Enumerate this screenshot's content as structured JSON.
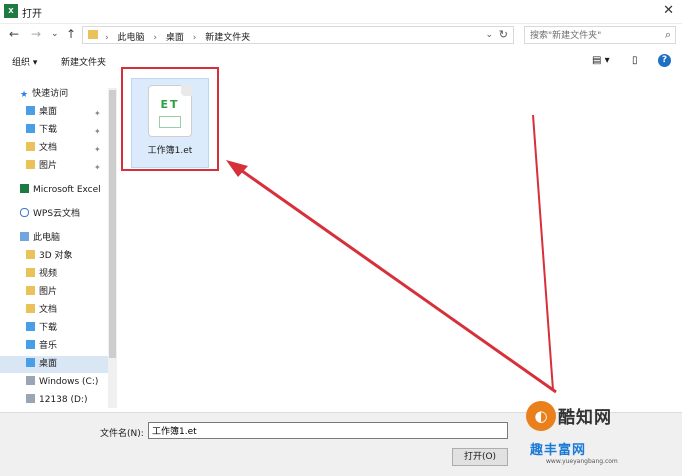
{
  "window": {
    "title": "打开",
    "app_icon_text": "X"
  },
  "nav": {
    "back": "←",
    "forward": "→",
    "recent": "⌄",
    "up": "↑",
    "breadcrumb": [
      "此电脑",
      "桌面",
      "新建文件夹"
    ],
    "search_placeholder": "搜索\"新建文件夹\""
  },
  "toolbar": {
    "organize": "组织 ▾",
    "new_folder": "新建文件夹",
    "help": "?"
  },
  "sidebar": {
    "quick_access": "快速访问",
    "quick_items": [
      "桌面",
      "下载",
      "文档",
      "图片"
    ],
    "excel": "Microsoft Excel",
    "wps": "WPS云文档",
    "this_pc": "此电脑",
    "pc_items": [
      "3D 对象",
      "视频",
      "图片",
      "文档",
      "下载",
      "音乐",
      "桌面",
      "Windows (C:)",
      "12138 (D:)"
    ]
  },
  "file": {
    "icon_text": "ET",
    "name": "工作簿1.et"
  },
  "footer": {
    "filename_label": "文件名(N):",
    "filename_value": "工作簿1.et",
    "open_button": "打开(O)"
  },
  "watermark": {
    "brand": "酷知网",
    "site": "趣丰富网",
    "url": "www.yueyangbang.com"
  },
  "colors": {
    "highlight": "#d6303a",
    "accent": "#1f6fc5",
    "selection": "#dcebfb"
  }
}
